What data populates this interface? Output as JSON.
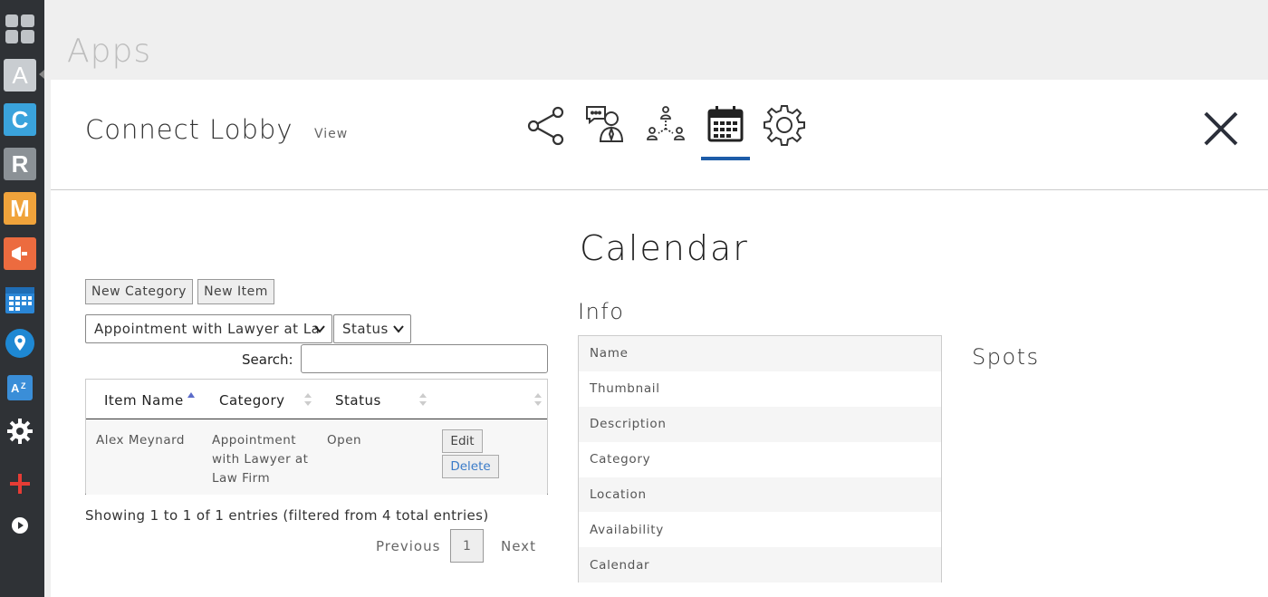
{
  "rail": {
    "items": [
      {
        "name": "dashboard-icon",
        "glyph": ""
      },
      {
        "name": "app-a-icon",
        "glyph": "A"
      },
      {
        "name": "app-c-icon",
        "glyph": "C"
      },
      {
        "name": "app-r-icon",
        "glyph": "R"
      },
      {
        "name": "app-m-icon",
        "glyph": "M"
      },
      {
        "name": "megaphone-icon",
        "glyph": ""
      },
      {
        "name": "calendar-app-icon",
        "glyph": ""
      },
      {
        "name": "location-pin-icon",
        "glyph": ""
      },
      {
        "name": "translate-icon",
        "glyph": ""
      },
      {
        "name": "settings-icon",
        "glyph": ""
      },
      {
        "name": "add-icon",
        "glyph": ""
      },
      {
        "name": "play-icon",
        "glyph": ""
      }
    ]
  },
  "page": {
    "title": "Apps"
  },
  "header": {
    "app_name": "Connect Lobby",
    "view_link": "View",
    "nav_icons": [
      "share-icon",
      "chat-person-icon",
      "network-people-icon",
      "calendar-icon",
      "gear-icon"
    ],
    "active_icon": "calendar-icon",
    "accent": "#1d5ca8"
  },
  "list": {
    "new_category": "New Category",
    "new_item": "New Item",
    "category_filter": "Appointment with Lawyer at La",
    "status_filter": "Status",
    "search_label": "Search:",
    "search_value": "",
    "columns": [
      "Item Name",
      "Category",
      "Status",
      ""
    ],
    "rows": [
      {
        "item_name": "Alex Meynard",
        "category_line1": "Appointment",
        "category_line2": "with Lawyer at",
        "category_line3": "Law Firm",
        "status": "Open",
        "edit": "Edit",
        "delete": "Delete"
      }
    ],
    "info": "Showing 1 to 1 of 1 entries (filtered from 4 total entries)",
    "previous": "Previous",
    "page": "1",
    "next": "Next"
  },
  "detail": {
    "title": "Calendar",
    "info_title": "Info",
    "fields": [
      "Name",
      "Thumbnail",
      "Description",
      "Category",
      "Location",
      "Availability",
      "Calendar"
    ],
    "spots_title": "Spots"
  }
}
